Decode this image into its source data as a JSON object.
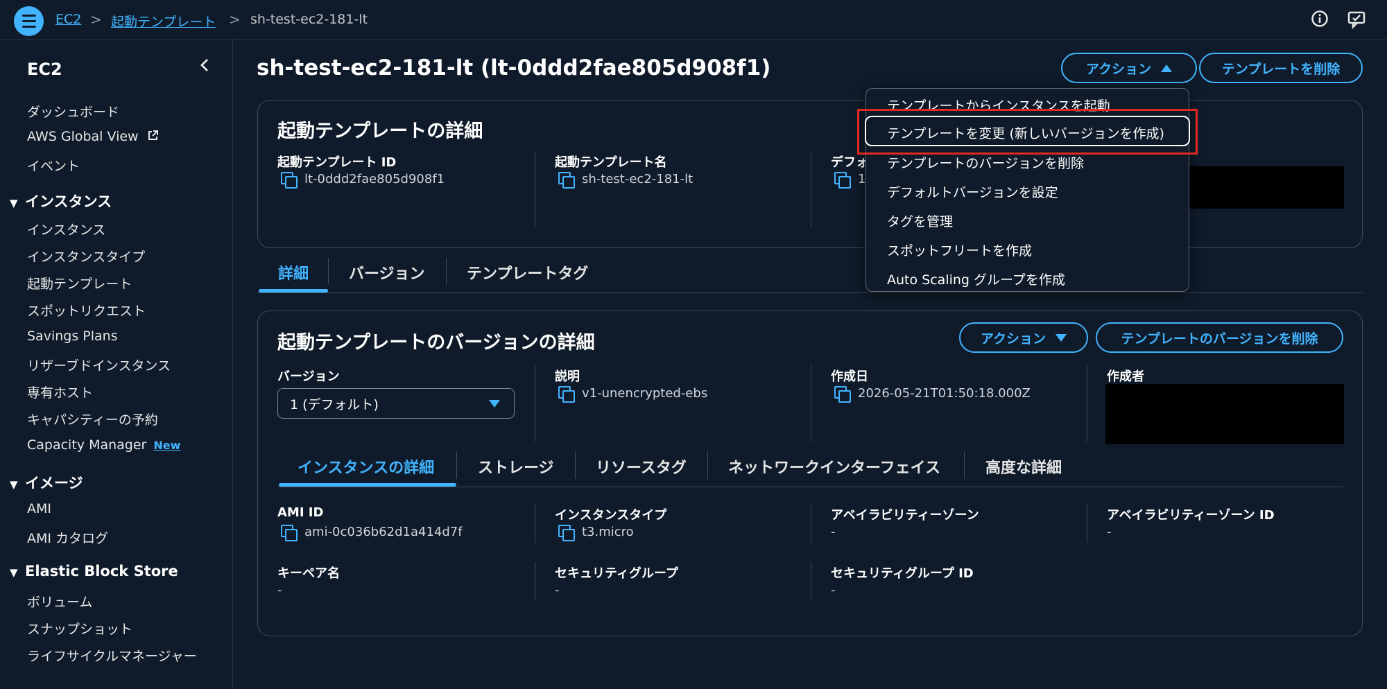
{
  "breadcrumb": {
    "service": "EC2",
    "section": "起動テンプレート",
    "current": "sh-test-ec2-181-lt",
    "separator": ">"
  },
  "sidebar": {
    "title": "EC2",
    "items": {
      "dashboard": "ダッシュボード",
      "global_view": "AWS Global View",
      "events": "イベント",
      "instances_section": "インスタンス",
      "instances": "インスタンス",
      "instance_types": "インスタンスタイプ",
      "launch_templates": "起動テンプレート",
      "spot_requests": "スポットリクエスト",
      "savings_plans": "Savings Plans",
      "reserved_instances": "リザーブドインスタンス",
      "dedicated_hosts": "専有ホスト",
      "capacity_reservations": "キャパシティーの予約",
      "capacity_manager": "Capacity Manager",
      "capacity_manager_badge": "New",
      "images_section": "イメージ",
      "ami": "AMI",
      "ami_catalog": "AMI カタログ",
      "ebs_section": "Elastic Block Store",
      "volumes": "ボリューム",
      "snapshots": "スナップショット",
      "lifecycle_manager": "ライフサイクルマネージャー"
    }
  },
  "page": {
    "title": "sh-test-ec2-181-lt (lt-0ddd2fae805d908f1)",
    "actions_label": "アクション",
    "delete_template_label": "テンプレートを削除"
  },
  "template_details": {
    "heading": "起動テンプレートの詳細",
    "id_label": "起動テンプレート ID",
    "id_value": "lt-0ddd2fae805d908f1",
    "name_label": "起動テンプレート名",
    "name_value": "sh-test-ec2-181-lt",
    "default_label": "デフォ",
    "default_value": "1"
  },
  "dropdown_menu": [
    "テンプレートからインスタンスを起動",
    "テンプレートを変更 (新しいバージョンを作成)",
    "テンプレートのバージョンを削除",
    "デフォルトバージョンを設定",
    "タグを管理",
    "スポットフリートを作成",
    "Auto Scaling グループを作成"
  ],
  "main_tabs": [
    "詳細",
    "バージョン",
    "テンプレートタグ"
  ],
  "version_details": {
    "heading": "起動テンプレートのバージョンの詳細",
    "actions_label": "アクション",
    "delete_version_label": "テンプレートのバージョンを削除",
    "version_label": "バージョン",
    "version_selected": "1 (デフォルト)",
    "description_label": "説明",
    "description_value": "v1-unencrypted-ebs",
    "created_label": "作成日",
    "created_value": "2026-05-21T01:50:18.000Z",
    "creator_label": "作成者"
  },
  "sub_tabs": [
    "インスタンスの詳細",
    "ストレージ",
    "リソースタグ",
    "ネットワークインターフェイス",
    "高度な詳細"
  ],
  "instance_details": {
    "ami_label": "AMI ID",
    "ami_value": "ami-0c036b62d1a414d7f",
    "type_label": "インスタンスタイプ",
    "type_value": "t3.micro",
    "az_label": "アベイラビリティーゾーン",
    "az_value": "-",
    "az_id_label": "アベイラビリティーゾーン ID",
    "az_id_value": "-",
    "keypair_label": "キーペア名",
    "keypair_value": "-",
    "sg_label": "セキュリティグループ",
    "sg_value": "-",
    "sg_id_label": "セキュリティグループ ID",
    "sg_id_value": "-"
  },
  "colors": {
    "background": "#0f1b2a",
    "accent": "#42b4ff",
    "highlight": "#e0291f",
    "border": "#414d5c"
  },
  "icons": [
    "menu-icon",
    "info-icon",
    "feedback-icon",
    "collapse-icon",
    "external-link-icon",
    "caret-up-icon",
    "caret-down-icon",
    "copy-icon"
  ]
}
